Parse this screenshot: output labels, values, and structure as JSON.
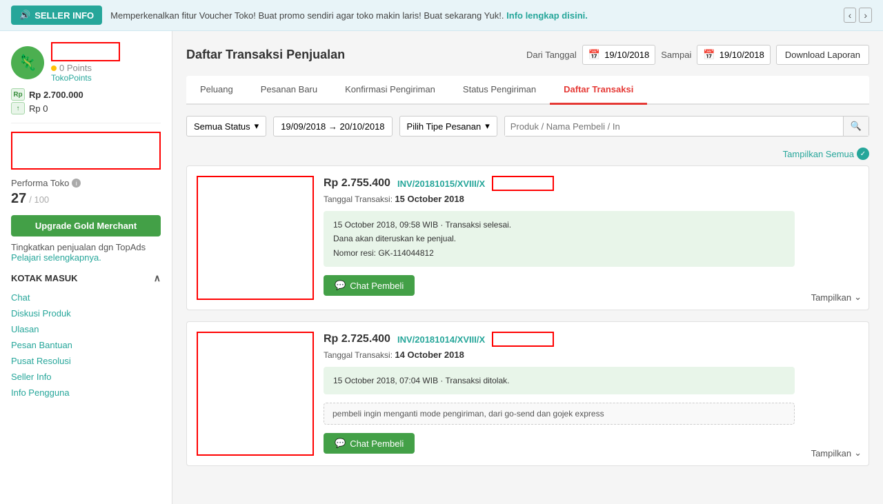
{
  "banner": {
    "badge": "SELLER INFO",
    "text": "Memperkenalkan fitur Voucher Toko! Buat promo sendiri agar toko makin laris! Buat sekarang Yuk!.",
    "link": "Info lengkap disini.",
    "prev": "‹",
    "next": "›"
  },
  "sidebar": {
    "points_text": "0 Points",
    "toko_points": "TokoPoints",
    "balance1_label": "Rp 2.700.000",
    "balance2_label": "Rp 0",
    "performa_label": "Performa Toko",
    "performa_score": "27",
    "performa_total": "/ 100",
    "upgrade_btn": "Upgrade Gold Merchant",
    "topads_text": "Tingkatkan penjualan dgn TopAds",
    "topads_link": "Pelajari selengkapnya.",
    "kotak_masuk": "KOTAK MASUK",
    "menu_items": [
      {
        "label": "Chat"
      },
      {
        "label": "Diskusi Produk"
      },
      {
        "label": "Ulasan"
      },
      {
        "label": "Pesan Bantuan"
      },
      {
        "label": "Pusat Resolusi"
      },
      {
        "label": "Seller Info"
      },
      {
        "label": "Info Pengguna"
      }
    ]
  },
  "header": {
    "title": "Daftar Transaksi Penjualan",
    "dari_label": "Dari Tanggal",
    "sampai_label": "Sampai",
    "date_from": "19/10/2018",
    "date_to": "19/10/2018",
    "download_btn": "Download Laporan"
  },
  "tabs": [
    {
      "label": "Peluang",
      "active": false
    },
    {
      "label": "Pesanan Baru",
      "active": false
    },
    {
      "label": "Konfirmasi Pengiriman",
      "active": false
    },
    {
      "label": "Status Pengiriman",
      "active": false
    },
    {
      "label": "Daftar Transaksi",
      "active": true
    }
  ],
  "filters": {
    "status_placeholder": "Semua Status",
    "date_range": "19/09/2018 → 20/10/2018",
    "type_placeholder": "Pilih Tipe Pesanan",
    "search_placeholder": "Produk / Nama Pembeli / In"
  },
  "tampilkan_semua": "Tampilkan Semua",
  "transactions": [
    {
      "amount": "Rp 2.755.400",
      "invoice": "INV/20181015/XVIII/X",
      "date_label": "Tanggal Transaksi:",
      "date_value": "15 October 2018",
      "status_lines": [
        "15 October 2018, 09:58 WIB · Transaksi selesai.",
        "Dana akan diteruskan ke penjual.",
        "Nomor resi: GK-114044812"
      ],
      "chat_btn": "Chat Pembeli",
      "tampilkan": "Tampilkan"
    },
    {
      "amount": "Rp 2.725.400",
      "invoice": "INV/20181014/XVIII/X",
      "date_label": "Tanggal Transaksi:",
      "date_value": "14 October 2018",
      "status_lines": [
        "15 October 2018, 07:04 WIB · Transaksi ditolak."
      ],
      "note": "pembeli ingin menganti mode pengiriman, dari go-send dan gojek express",
      "chat_btn": "Chat Pembeli",
      "tampilkan": "Tampilkan"
    }
  ]
}
